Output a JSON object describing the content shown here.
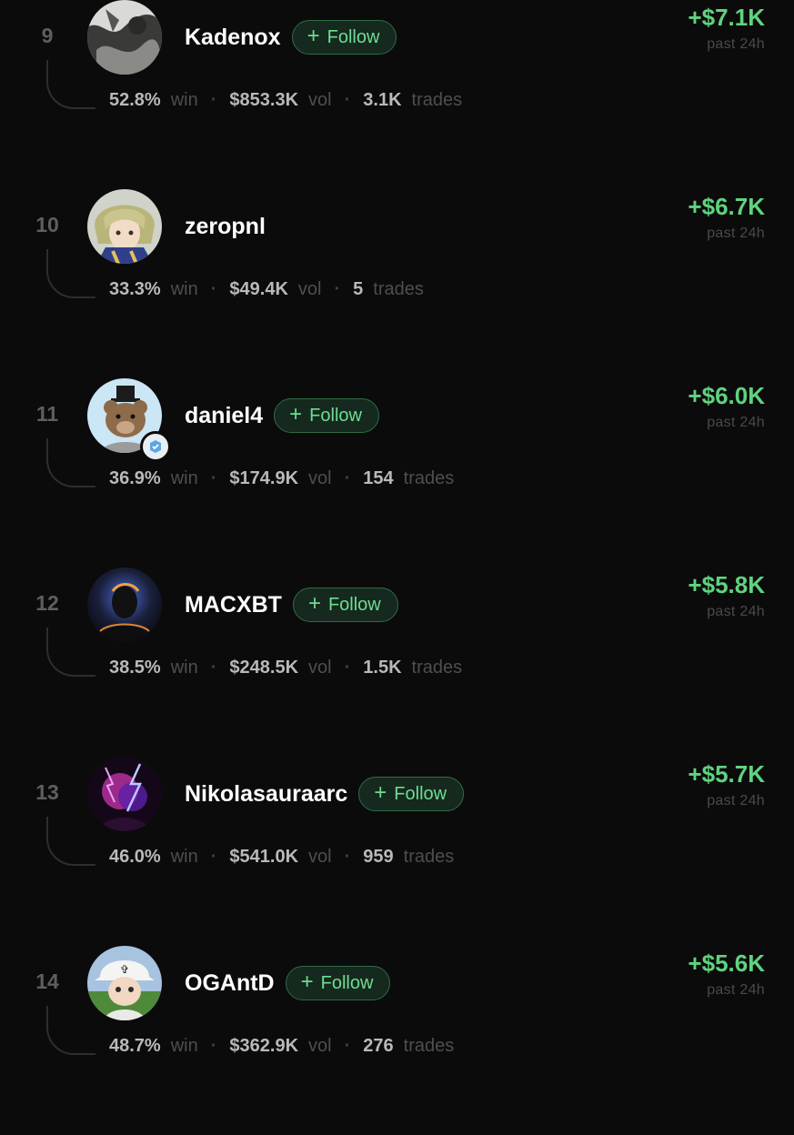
{
  "leaderboard": {
    "follow_label": "Follow",
    "rows": [
      {
        "rank": "9",
        "name": "Kadenox",
        "show_follow": true,
        "verified": false,
        "pnl": "+$7.1K",
        "period": "past 24h",
        "win": "52.8%",
        "win_label": "win",
        "vol": "$853.3K",
        "vol_label": "vol",
        "trades": "3.1K",
        "trades_label": "trades",
        "avatar": "kadenox-avatar"
      },
      {
        "rank": "10",
        "name": "zeropnl",
        "show_follow": false,
        "verified": false,
        "pnl": "+$6.7K",
        "period": "past 24h",
        "win": "33.3%",
        "win_label": "win",
        "vol": "$49.4K",
        "vol_label": "vol",
        "trades": "5",
        "trades_label": "trades",
        "avatar": "zeropnl-avatar"
      },
      {
        "rank": "11",
        "name": "daniel4",
        "show_follow": true,
        "verified": true,
        "pnl": "+$6.0K",
        "period": "past 24h",
        "win": "36.9%",
        "win_label": "win",
        "vol": "$174.9K",
        "vol_label": "vol",
        "trades": "154",
        "trades_label": "trades",
        "avatar": "daniel4-avatar"
      },
      {
        "rank": "12",
        "name": "MACXBT",
        "show_follow": true,
        "verified": false,
        "pnl": "+$5.8K",
        "period": "past 24h",
        "win": "38.5%",
        "win_label": "win",
        "vol": "$248.5K",
        "vol_label": "vol",
        "trades": "1.5K",
        "trades_label": "trades",
        "avatar": "macxbt-avatar"
      },
      {
        "rank": "13",
        "name": "Nikolasauraarc",
        "show_follow": true,
        "verified": false,
        "pnl": "+$5.7K",
        "period": "past 24h",
        "win": "46.0%",
        "win_label": "win",
        "vol": "$541.0K",
        "vol_label": "vol",
        "trades": "959",
        "trades_label": "trades",
        "avatar": "nikolasauraarc-avatar"
      },
      {
        "rank": "14",
        "name": "OGAntD",
        "show_follow": true,
        "verified": false,
        "pnl": "+$5.6K",
        "period": "past 24h",
        "win": "48.7%",
        "win_label": "win",
        "vol": "$362.9K",
        "vol_label": "vol",
        "trades": "276",
        "trades_label": "trades",
        "avatar": "ogantd-avatar"
      }
    ]
  },
  "colors": {
    "background": "#0b0b0c",
    "positive": "#5fd37e",
    "follow_text": "#6fdc92",
    "follow_bg": "#15291e"
  },
  "icons": {
    "follow": "plus-icon",
    "verified": "verified-badge-icon"
  }
}
